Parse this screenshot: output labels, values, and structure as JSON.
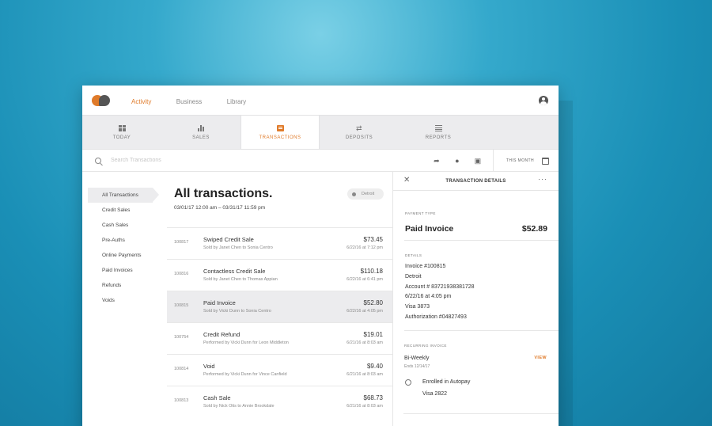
{
  "topnav": {
    "items": [
      "Activity",
      "Business",
      "Library"
    ],
    "active": "Activity"
  },
  "tabs": [
    {
      "label": "TODAY",
      "icon": "grid-icon"
    },
    {
      "label": "SALES",
      "icon": "bar-chart-icon"
    },
    {
      "label": "TRANSACTIONS",
      "icon": "receipt-icon"
    },
    {
      "label": "DEPOSITS",
      "icon": "transfer-icon"
    },
    {
      "label": "REPORTS",
      "icon": "list-icon"
    }
  ],
  "search": {
    "placeholder": "Search Transactions",
    "period": "THIS MONTH"
  },
  "sidebar": {
    "items": [
      "All Transactions",
      "Credit Sales",
      "Cash Sales",
      "Pre-Auths",
      "Online Payments",
      "Paid Invoices",
      "Refunds",
      "Voids"
    ]
  },
  "list": {
    "title": "All transactions.",
    "range": "03/01/17 12:00 am – 03/31/17 11:59 pm",
    "location": "Detroit",
    "rows": [
      {
        "id": "100817",
        "name": "Swiped Credit Sale",
        "sub": "Sold by Janet Chen to Sonia Centro",
        "amount": "$73.45",
        "date": "6/22/16 at 7:12 pm"
      },
      {
        "id": "100816",
        "name": "Contactless Credit Sale",
        "sub": "Sold by Janet Chen to Thomas Appian",
        "amount": "$110.18",
        "date": "6/22/16 at 6:41 pm"
      },
      {
        "id": "100815",
        "name": "Paid Invoice",
        "sub": "Sold by Vicki Dunn to Sonia Centro",
        "amount": "$52.80",
        "date": "6/22/16 at 4:05 pm"
      },
      {
        "id": "100754",
        "name": "Credit Refund",
        "sub": "Performed by Vicki Dunn for Leon Middleton",
        "amount": "$19.01",
        "date": "6/21/16 at 8:03 am"
      },
      {
        "id": "100814",
        "name": "Void",
        "sub": "Performed by Vicki Dunn for Vince Canfield",
        "amount": "$9.40",
        "date": "6/21/16 at 8:03 am"
      },
      {
        "id": "100813",
        "name": "Cash Sale",
        "sub": "Sold by Nick Otis to Annie Brookdale",
        "amount": "$68.73",
        "date": "6/21/16 at 8:03 am"
      }
    ]
  },
  "detail": {
    "title": "TRANSACTION DETAILS",
    "payment_type_label": "PAYMENT TYPE",
    "payment_type": "Paid Invoice",
    "amount": "$52.89",
    "details_label": "DETAILS",
    "lines": [
      "Invoice #100815",
      "Detroit",
      "Account # 83721938381728",
      "6/22/16 at 4:05 pm",
      "Visa 3873",
      "Authorization #04827493"
    ],
    "recurring_label": "RECURRING INVOICE",
    "recurring_title": "Bi-Weekly",
    "recurring_end": "Ends 12/14/17",
    "view": "VIEW",
    "autopay": "Enrolled in Autopay",
    "autopay_card": "Visa 2822"
  },
  "colors": {
    "accent": "#e07b2a",
    "background": "#1a8fb6"
  }
}
